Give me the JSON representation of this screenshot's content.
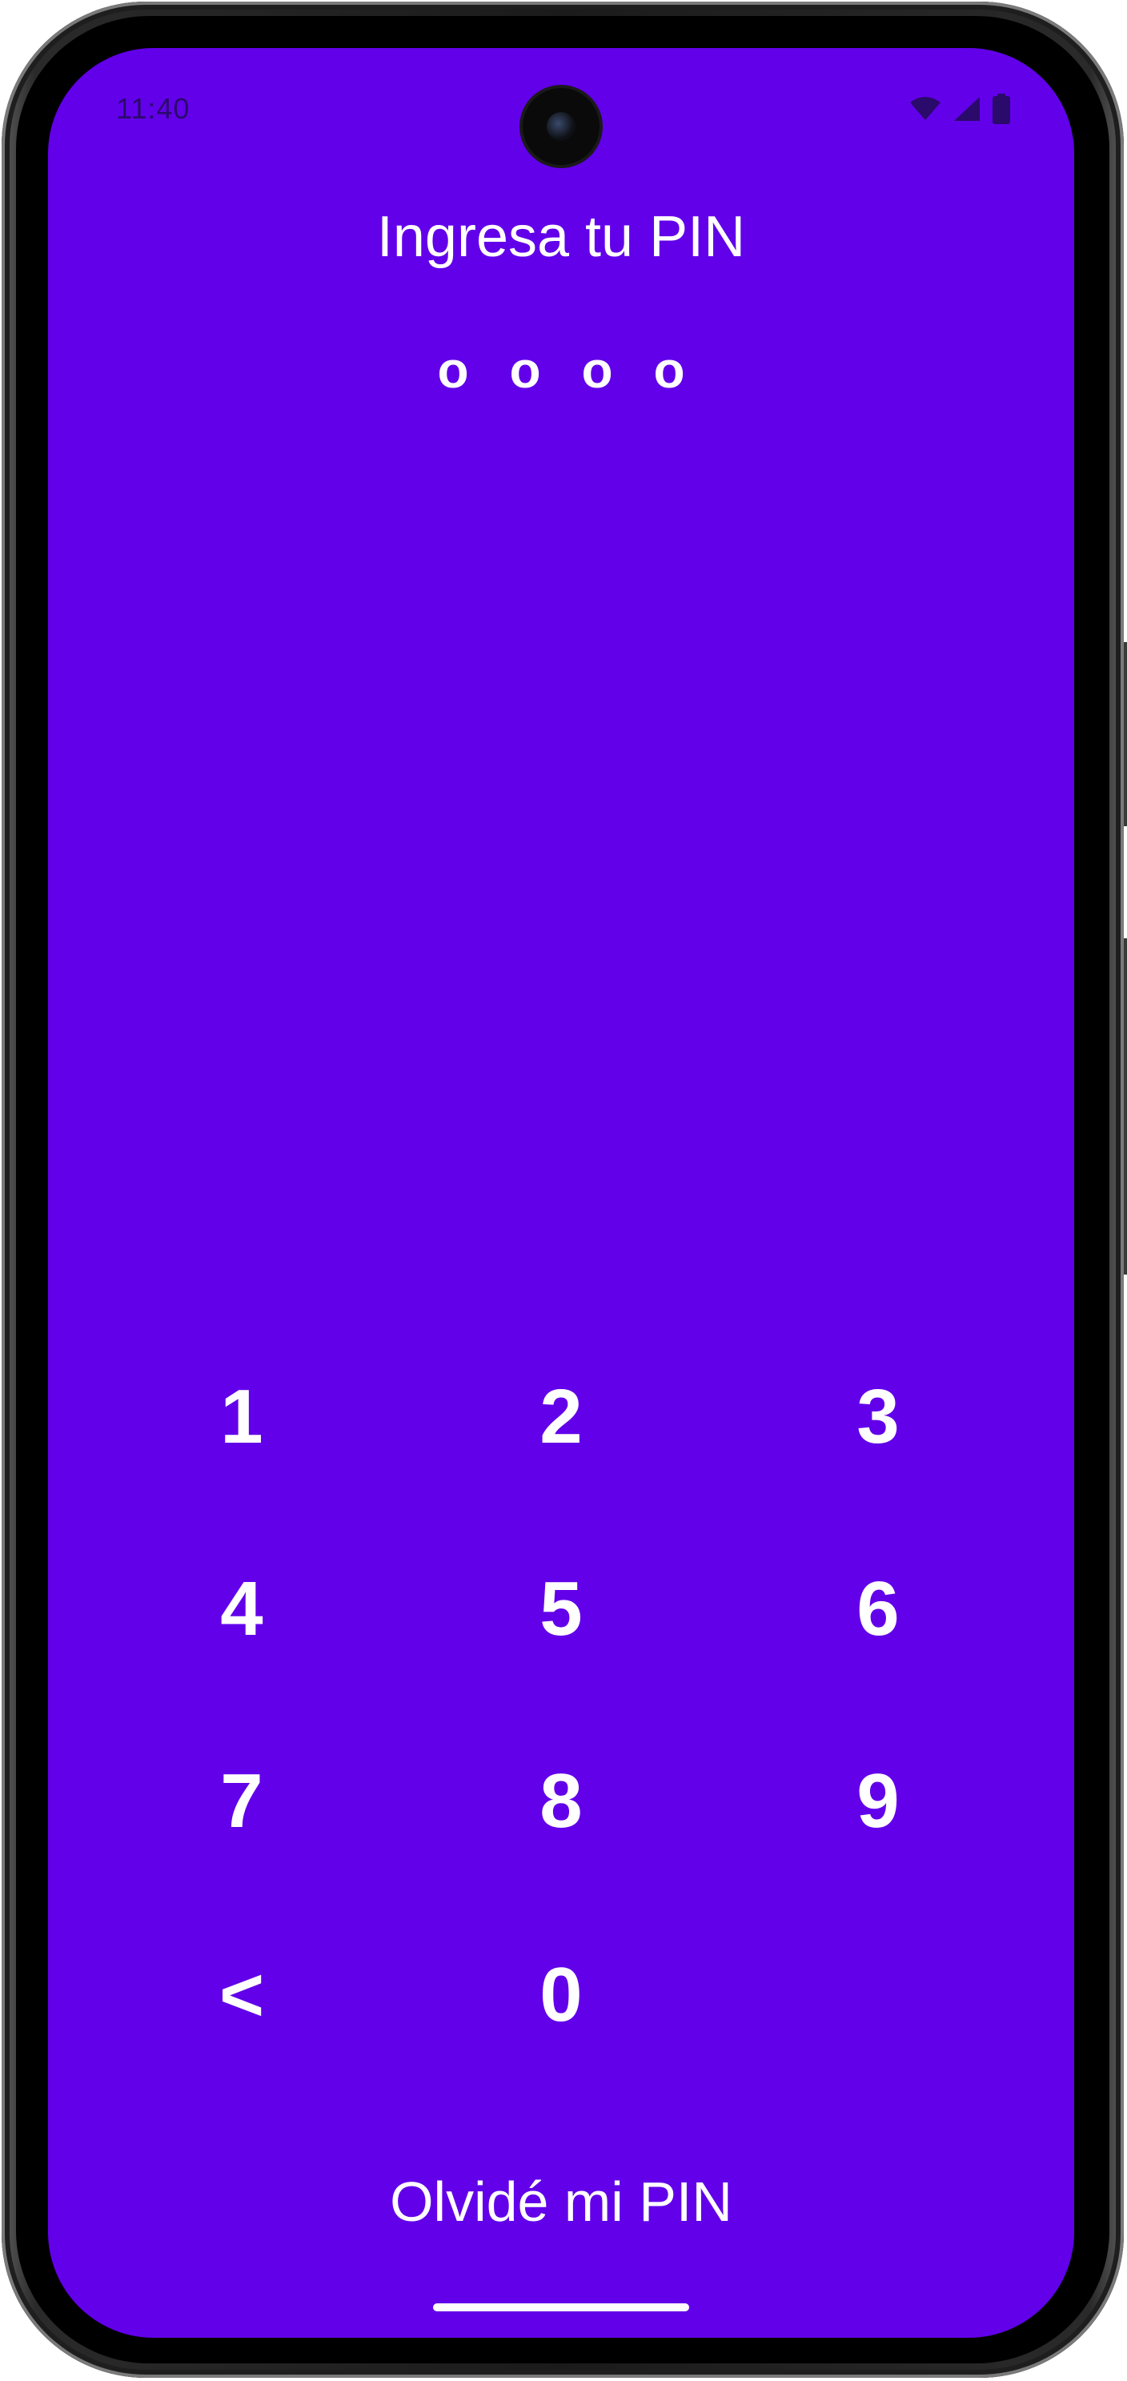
{
  "status_bar": {
    "time": "11:40",
    "icons": [
      "wifi-icon",
      "cellular-signal-icon",
      "battery-icon"
    ]
  },
  "pin_screen": {
    "title": "Ingresa tu PIN",
    "pin_placeholders": [
      "o",
      "o",
      "o",
      "o"
    ],
    "background_color": "#6200EA",
    "keypad": {
      "k1": "1",
      "k2": "2",
      "k3": "3",
      "k4": "4",
      "k5": "5",
      "k6": "6",
      "k7": "7",
      "k8": "8",
      "k9": "9",
      "back": "<",
      "k0": "0"
    },
    "forgot_link": "Olvidé mi PIN"
  }
}
